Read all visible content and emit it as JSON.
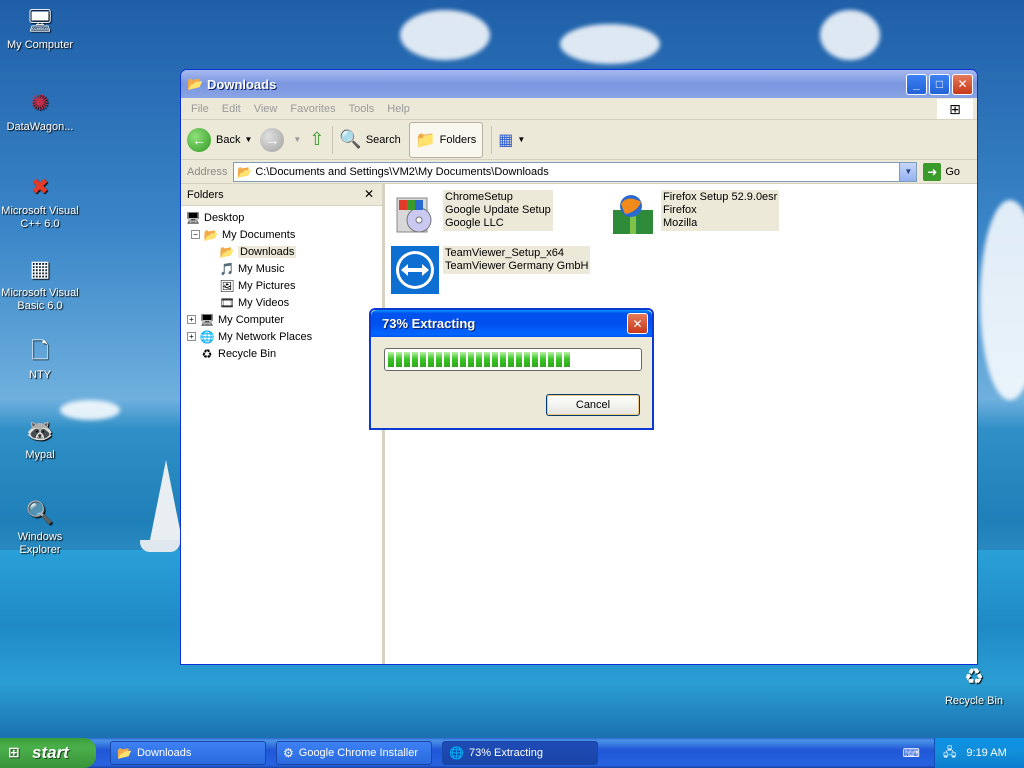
{
  "desktop": {
    "icons": [
      {
        "label": "My Computer",
        "icon": "computer-icon"
      },
      {
        "label": "DataWagon...",
        "icon": "datawagon-icon"
      },
      {
        "label": "Microsoft Visual C++ 6.0",
        "icon": "visual-cpp-icon"
      },
      {
        "label": "Microsoft Visual Basic 6.0",
        "icon": "visual-basic-icon"
      },
      {
        "label": "NTY",
        "icon": "blank-file-icon"
      },
      {
        "label": "Mypal",
        "icon": "mypal-icon"
      },
      {
        "label": "Windows Explorer",
        "icon": "explorer-icon"
      },
      {
        "label": "Recycle Bin",
        "icon": "recycle-bin-icon"
      }
    ]
  },
  "window": {
    "title": "Downloads",
    "menu": [
      "File",
      "Edit",
      "View",
      "Favorites",
      "Tools",
      "Help"
    ],
    "toolbar": {
      "back": "Back",
      "search": "Search",
      "folders": "Folders"
    },
    "address": {
      "label": "Address",
      "value": "C:\\Documents and Settings\\VM2\\My Documents\\Downloads",
      "go": "Go"
    },
    "folders_pane": {
      "title": "Folders",
      "tree": [
        {
          "label": "Desktop",
          "level": 0,
          "expander": ""
        },
        {
          "label": "My Documents",
          "level": 1,
          "expander": "−"
        },
        {
          "label": "Downloads",
          "level": 2,
          "expander": "",
          "selected": true
        },
        {
          "label": "My Music",
          "level": 2,
          "expander": ""
        },
        {
          "label": "My Pictures",
          "level": 2,
          "expander": ""
        },
        {
          "label": "My Videos",
          "level": 2,
          "expander": ""
        },
        {
          "label": "My Computer",
          "level": 1,
          "expander": "+"
        },
        {
          "label": "My Network Places",
          "level": 1,
          "expander": "+"
        },
        {
          "label": "Recycle Bin",
          "level": 1,
          "expander": ""
        }
      ]
    },
    "files": [
      {
        "lines": [
          "ChromeSetup",
          "Google Update Setup",
          "Google LLC"
        ],
        "icon": "chrome-setup-icon"
      },
      {
        "lines": [
          "Firefox Setup 52.9.0esr",
          "Firefox",
          "Mozilla"
        ],
        "icon": "firefox-setup-icon"
      },
      {
        "lines": [
          "TeamViewer_Setup_x64",
          "TeamViewer Germany GmbH"
        ],
        "icon": "teamviewer-icon"
      }
    ]
  },
  "dialog": {
    "title": "73% Extracting",
    "progress": 0.73,
    "cancel": "Cancel"
  },
  "taskbar": {
    "start": "start",
    "tasks": [
      {
        "label": "Downloads",
        "active": false
      },
      {
        "label": "Google Chrome Installer",
        "active": false
      },
      {
        "label": "73% Extracting",
        "active": true
      }
    ],
    "clock": "9:19 AM"
  },
  "colors": {
    "titlebar": "#0053ee",
    "progress_green": "#3fc42a",
    "taskbar": "#2157d7",
    "start_green": "#3c9e3c"
  }
}
